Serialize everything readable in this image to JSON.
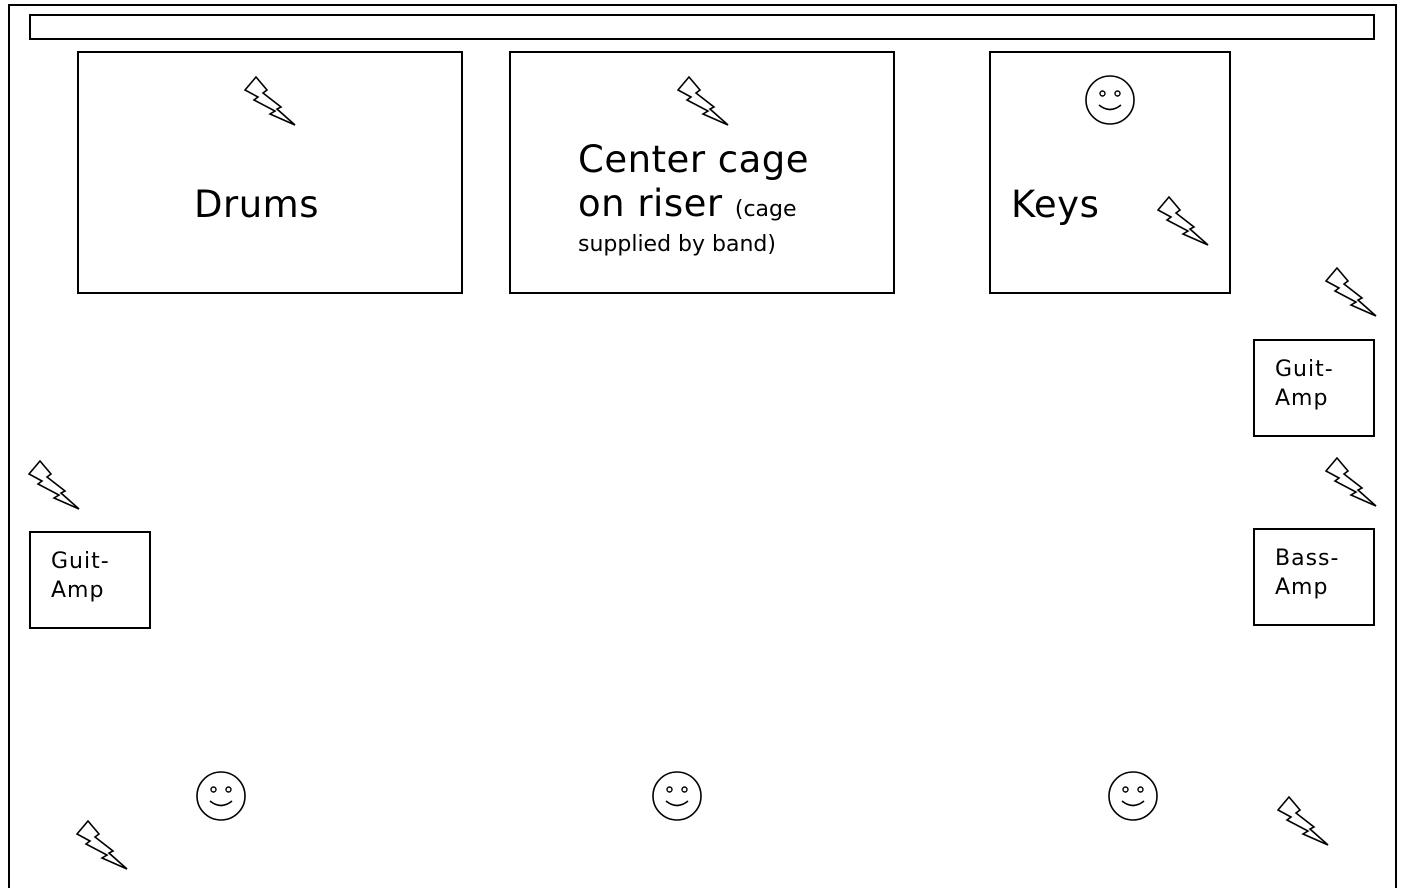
{
  "stage": {
    "drums_label": "Drums",
    "center": {
      "line1": "Center cage",
      "line2": "on riser",
      "note_open": "(cage",
      "note_line2": "supplied by band)"
    },
    "keys_label": "Keys",
    "amp_right_top": {
      "line1": "Guit-",
      "line2": "Amp"
    },
    "amp_left": {
      "line1": "Guit-",
      "line2": "Amp"
    },
    "amp_right_bottom": {
      "line1": "Bass-",
      "line2": "Amp"
    }
  },
  "icons": {
    "power": "lightning-bolt",
    "monitor": "smiley-face"
  }
}
